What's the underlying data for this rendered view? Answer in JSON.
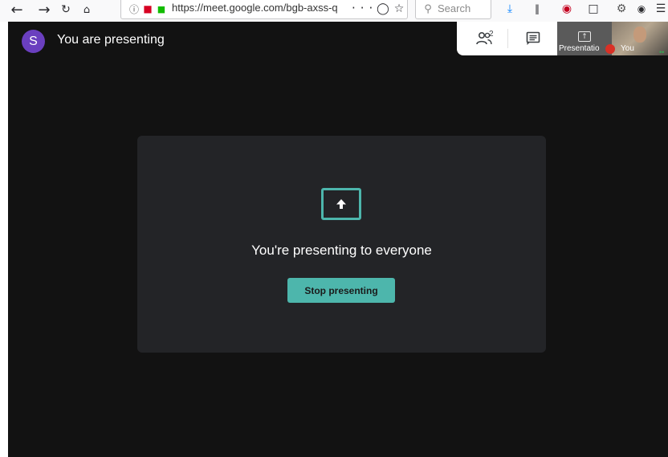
{
  "browser": {
    "url": "https://meet.google.com/bgb-axss-q",
    "search_placeholder": "Search",
    "more_glyph": "···"
  },
  "meet": {
    "avatar_letter": "S",
    "title": "You are presenting",
    "participant_count": "2",
    "thumbnail": {
      "left_label": "Presentatio",
      "right_label": "You"
    },
    "presenting": {
      "message": "You're presenting to everyone",
      "stop_button": "Stop presenting"
    }
  },
  "colors": {
    "meet_background": "#121212",
    "card_background": "#232427",
    "accent_teal": "#4db6ac",
    "avatar": "#6a3fbf"
  }
}
